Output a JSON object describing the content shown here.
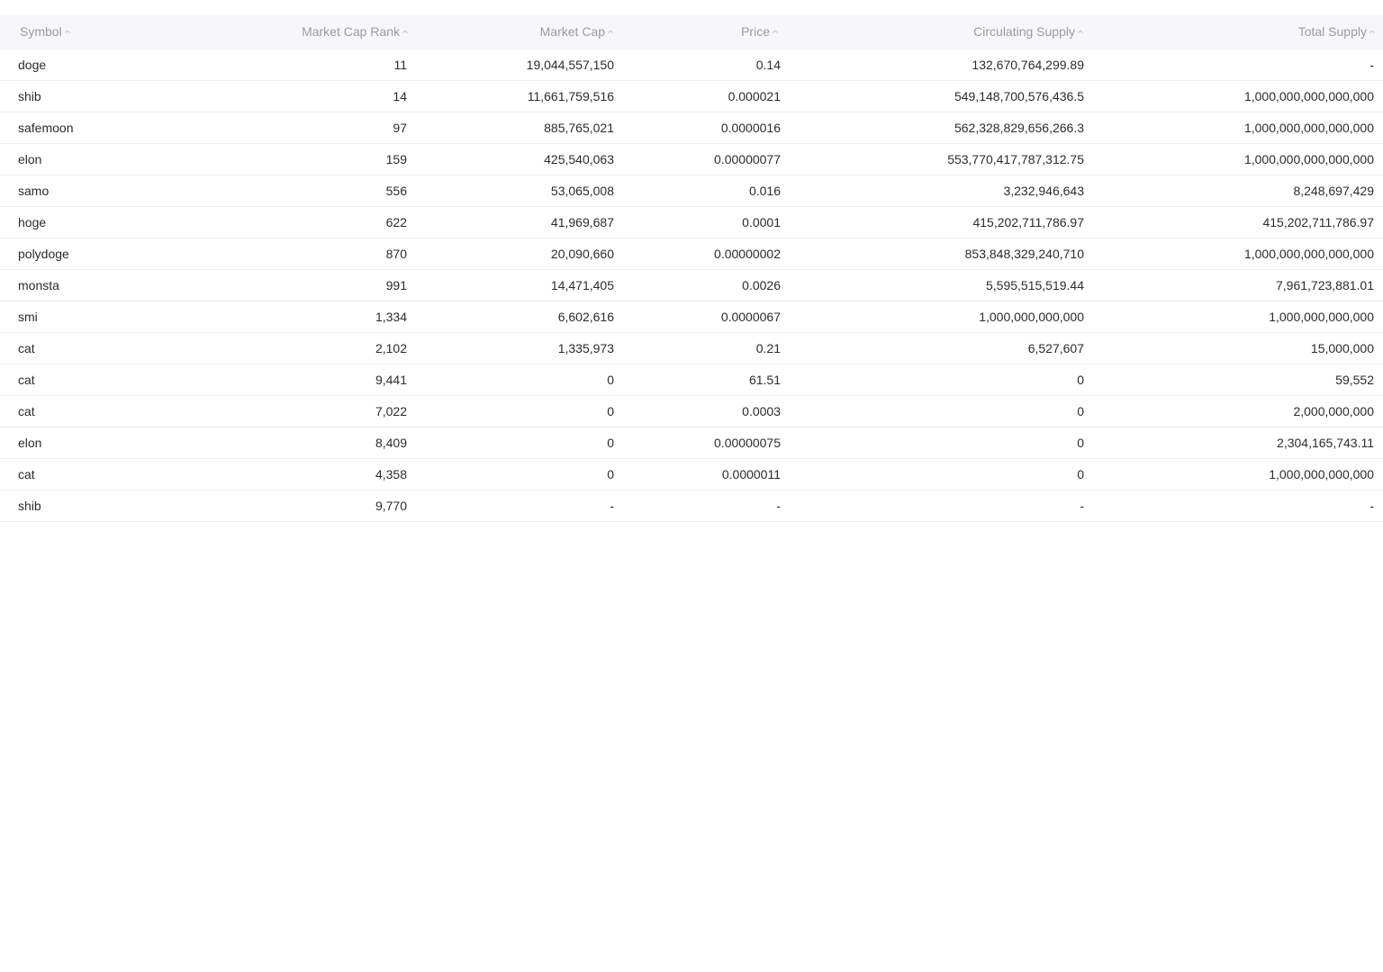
{
  "table": {
    "columns": [
      {
        "key": "symbol",
        "label": "Symbol",
        "icon": "sort-caret-up-icon"
      },
      {
        "key": "rank",
        "label": "Market Cap Rank",
        "icon": "sort-caret-up-icon"
      },
      {
        "key": "mcap",
        "label": "Market Cap",
        "icon": "sort-caret-up-icon"
      },
      {
        "key": "price",
        "label": "Price",
        "icon": "sort-caret-up-icon"
      },
      {
        "key": "circ",
        "label": "Circulating Supply",
        "icon": "sort-caret-up-icon"
      },
      {
        "key": "total",
        "label": "Total Supply",
        "icon": "sort-caret-up-icon"
      }
    ],
    "rows": [
      {
        "symbol": "doge",
        "rank": "11",
        "mcap": "19,044,557,150",
        "price": "0.14",
        "circ": "132,670,764,299.89",
        "total": "-"
      },
      {
        "symbol": "shib",
        "rank": "14",
        "mcap": "11,661,759,516",
        "price": "0.000021",
        "circ": "549,148,700,576,436.5",
        "total": "1,000,000,000,000,000"
      },
      {
        "symbol": "safemoon",
        "rank": "97",
        "mcap": "885,765,021",
        "price": "0.0000016",
        "circ": "562,328,829,656,266.3",
        "total": "1,000,000,000,000,000"
      },
      {
        "symbol": "elon",
        "rank": "159",
        "mcap": "425,540,063",
        "price": "0.00000077",
        "circ": "553,770,417,787,312.75",
        "total": "1,000,000,000,000,000"
      },
      {
        "symbol": "samo",
        "rank": "556",
        "mcap": "53,065,008",
        "price": "0.016",
        "circ": "3,232,946,643",
        "total": "8,248,697,429"
      },
      {
        "symbol": "hoge",
        "rank": "622",
        "mcap": "41,969,687",
        "price": "0.0001",
        "circ": "415,202,711,786.97",
        "total": "415,202,711,786.97"
      },
      {
        "symbol": "polydoge",
        "rank": "870",
        "mcap": "20,090,660",
        "price": "0.00000002",
        "circ": "853,848,329,240,710",
        "total": "1,000,000,000,000,000"
      },
      {
        "symbol": "monsta",
        "rank": "991",
        "mcap": "14,471,405",
        "price": "0.0026",
        "circ": "5,595,515,519.44",
        "total": "7,961,723,881.01"
      },
      {
        "symbol": "smi",
        "rank": "1,334",
        "mcap": "6,602,616",
        "price": "0.0000067",
        "circ": "1,000,000,000,000",
        "total": "1,000,000,000,000"
      },
      {
        "symbol": "cat",
        "rank": "2,102",
        "mcap": "1,335,973",
        "price": "0.21",
        "circ": "6,527,607",
        "total": "15,000,000"
      },
      {
        "symbol": "cat",
        "rank": "9,441",
        "mcap": "0",
        "price": "61.51",
        "circ": "0",
        "total": "59,552"
      },
      {
        "symbol": "cat",
        "rank": "7,022",
        "mcap": "0",
        "price": "0.0003",
        "circ": "0",
        "total": "2,000,000,000"
      },
      {
        "symbol": "elon",
        "rank": "8,409",
        "mcap": "0",
        "price": "0.00000075",
        "circ": "0",
        "total": "2,304,165,743.11"
      },
      {
        "symbol": "cat",
        "rank": "4,358",
        "mcap": "0",
        "price": "0.0000011",
        "circ": "0",
        "total": "1,000,000,000,000"
      },
      {
        "symbol": "shib",
        "rank": "9,770",
        "mcap": "-",
        "price": "-",
        "circ": "-",
        "total": "-"
      }
    ]
  },
  "colors": {
    "header_bg": "#f7f7fb",
    "header_text": "#9a9aa6",
    "cell_text": "#2b2b33",
    "row_border": "#eeeef2"
  }
}
